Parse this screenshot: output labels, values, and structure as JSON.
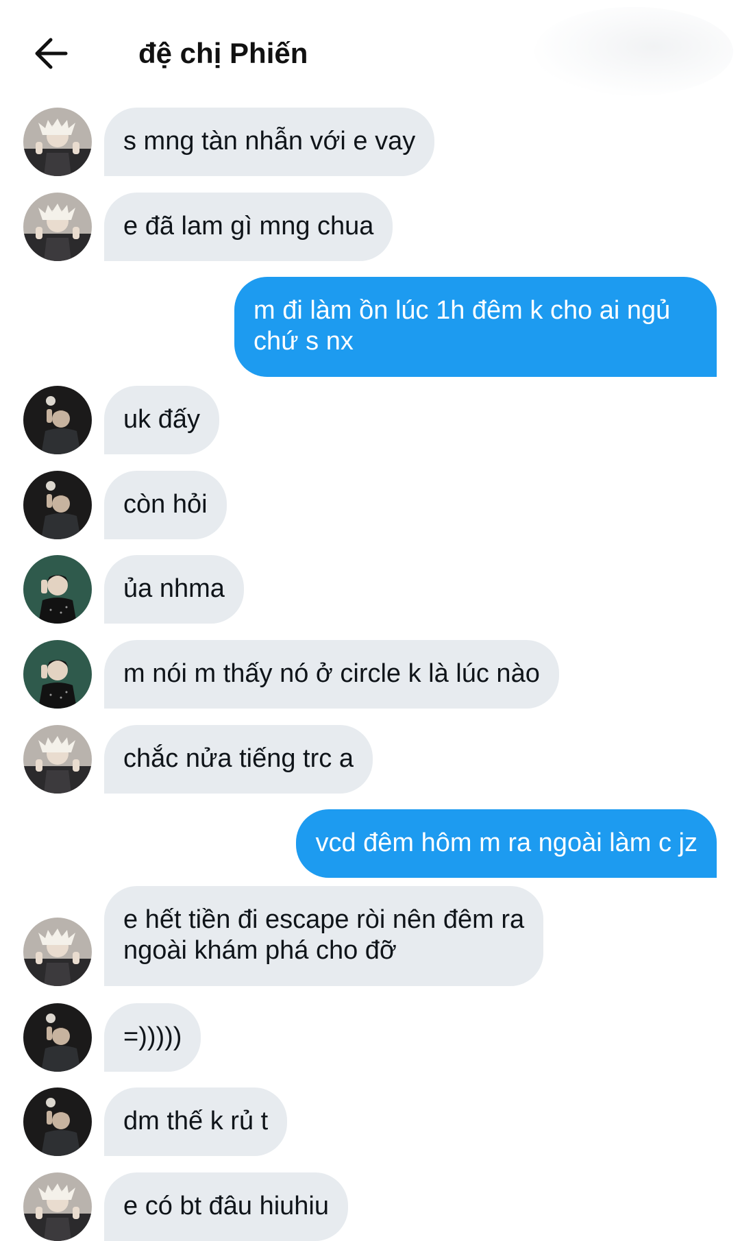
{
  "header": {
    "title": "đệ chị Phiến",
    "back_icon": "arrow-left-icon"
  },
  "colors": {
    "incoming_bubble": "#e7ebef",
    "outgoing_bubble": "#1d9bf0",
    "text": "#0f1419"
  },
  "messages": [
    {
      "sender": "other",
      "avatar": "blonde-user",
      "text": "s mng tàn nhẫn với e vay"
    },
    {
      "sender": "other",
      "avatar": "blonde-user",
      "text": "e đã lam gì mng chua"
    },
    {
      "sender": "me",
      "text": "m đi làm ồn lúc 1h đêm k cho ai ngủ\nchứ s nx"
    },
    {
      "sender": "other",
      "avatar": "dark-user",
      "text": "uk đấy"
    },
    {
      "sender": "other",
      "avatar": "dark-user",
      "text": "còn hỏi"
    },
    {
      "sender": "other",
      "avatar": "green-user",
      "text": "ủa nhma"
    },
    {
      "sender": "other",
      "avatar": "green-user",
      "text": "m nói m thấy nó ở circle k là lúc nào"
    },
    {
      "sender": "other",
      "avatar": "blonde-user",
      "text": "chắc nửa tiếng trc a"
    },
    {
      "sender": "me",
      "text": "vcd đêm hôm m ra ngoài làm c jz"
    },
    {
      "sender": "other",
      "avatar": "blonde-user",
      "text": "e hết tiền đi escape ròi nên đêm ra\nngoài khám phá cho đỡ"
    },
    {
      "sender": "other",
      "avatar": "dark-user",
      "text": "=)))))"
    },
    {
      "sender": "other",
      "avatar": "dark-user",
      "text": "dm thế k rủ t"
    },
    {
      "sender": "other",
      "avatar": "blonde-user",
      "text": "e có bt đâu hiuhiu"
    }
  ]
}
